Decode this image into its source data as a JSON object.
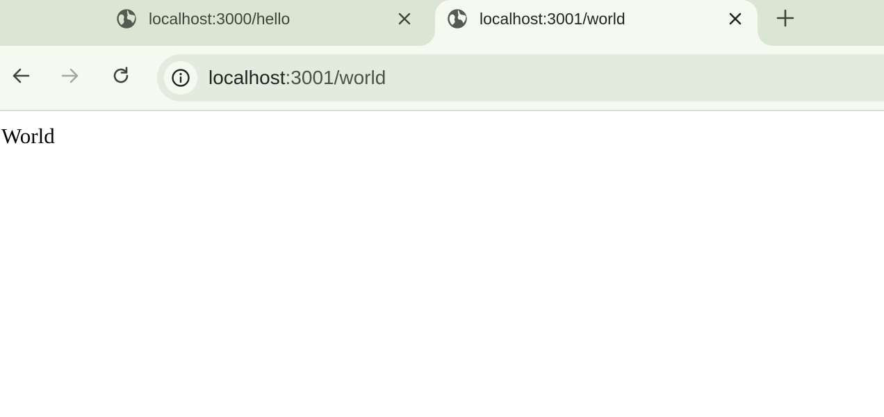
{
  "tabs": [
    {
      "title": "localhost:3000/hello",
      "favicon": "globe-icon",
      "close_icon": "close-icon",
      "active": false
    },
    {
      "title": "localhost:3001/world",
      "favicon": "globe-icon",
      "close_icon": "close-icon",
      "active": true
    }
  ],
  "new_tab_icon": "plus-icon",
  "toolbar": {
    "back_icon": "arrow-left-icon",
    "forward_icon": "arrow-right-icon",
    "reload_icon": "reload-icon"
  },
  "omnibox": {
    "site_info_icon": "info-icon",
    "url_host": "localhost",
    "url_path": ":3001/world"
  },
  "page": {
    "body_text": "World"
  },
  "colors": {
    "tab_strip_bg": "#dae6d3",
    "active_tab_bg": "#f5f9f0",
    "omnibox_bg": "#e3ebdf",
    "icon_color": "#3d443a",
    "disabled_icon_color": "#a2a99f"
  }
}
